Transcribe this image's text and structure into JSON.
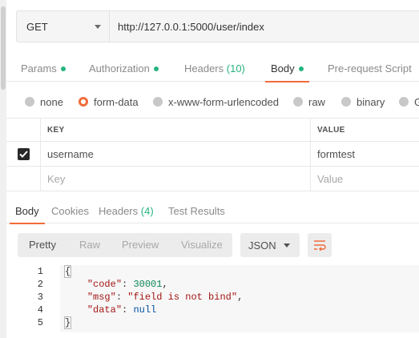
{
  "request": {
    "method": "GET",
    "url": "http://127.0.0.1:5000/user/index"
  },
  "request_tabs": [
    {
      "label": "Params",
      "dot": true
    },
    {
      "label": "Authorization",
      "dot": true
    },
    {
      "label": "Headers",
      "count": "(10)"
    },
    {
      "label": "Body",
      "dot": true,
      "active": true
    },
    {
      "label": "Pre-request Script"
    }
  ],
  "body_types": [
    {
      "label": "none",
      "checked": false
    },
    {
      "label": "form-data",
      "checked": true
    },
    {
      "label": "x-www-form-urlencoded",
      "checked": false
    },
    {
      "label": "raw",
      "checked": false
    },
    {
      "label": "binary",
      "checked": false
    },
    {
      "label": "G",
      "checked": false
    }
  ],
  "params_table": {
    "headers": {
      "key": "KEY",
      "value": "VALUE"
    },
    "rows": [
      {
        "checked": true,
        "key": "username",
        "value": "formtest"
      }
    ],
    "placeholder": {
      "key": "Key",
      "value": "Value"
    }
  },
  "response_tabs": [
    {
      "label": "Body",
      "active": true
    },
    {
      "label": "Cookies"
    },
    {
      "label": "Headers",
      "count": "(4)"
    },
    {
      "label": "Test Results"
    }
  ],
  "view_modes": [
    "Pretty",
    "Raw",
    "Preview",
    "Visualize"
  ],
  "active_view": "Pretty",
  "format": "JSON",
  "response_lines": [
    {
      "n": "1",
      "text": "{"
    },
    {
      "n": "2",
      "indent": "    ",
      "key": "\"code\"",
      "sep": ": ",
      "value": "30001",
      "vtype": "n",
      "tail": ","
    },
    {
      "n": "3",
      "indent": "    ",
      "key": "\"msg\"",
      "sep": ": ",
      "value": "\"field is not bind\"",
      "vtype": "s",
      "tail": ","
    },
    {
      "n": "4",
      "indent": "    ",
      "key": "\"data\"",
      "sep": ": ",
      "value": "null",
      "vtype": "kw",
      "tail": ""
    },
    {
      "n": "5",
      "text": "}"
    }
  ],
  "colors": {
    "accent": "#f26b3a",
    "dot": "#26b47f"
  }
}
